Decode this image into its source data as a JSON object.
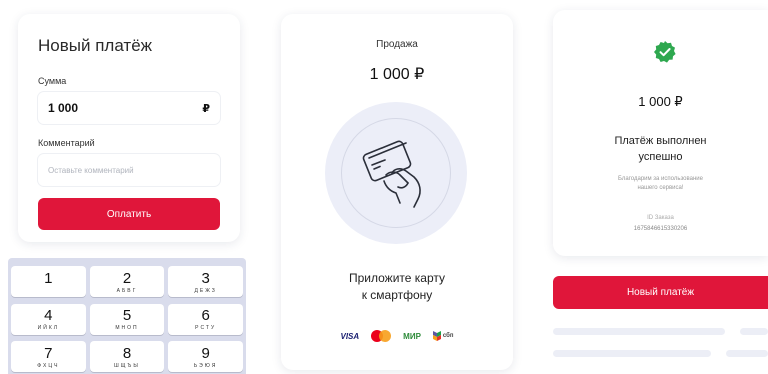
{
  "new_payment": {
    "title": "Новый платёж",
    "amount_label": "Сумма",
    "amount_value": "1 000",
    "currency_symbol": "₽",
    "comment_label": "Комментарий",
    "comment_placeholder": "Оставьте комментарий",
    "pay_button": "Оплатить"
  },
  "keypad": {
    "keys": [
      {
        "num": "1",
        "letters": ""
      },
      {
        "num": "2",
        "letters": "АБВГ"
      },
      {
        "num": "3",
        "letters": "ДЕЖЗ"
      },
      {
        "num": "4",
        "letters": "ИЙКЛ"
      },
      {
        "num": "5",
        "letters": "МНОП"
      },
      {
        "num": "6",
        "letters": "РСТУ"
      },
      {
        "num": "7",
        "letters": "ФХЦЧ"
      },
      {
        "num": "8",
        "letters": "ШЩЪЫ"
      },
      {
        "num": "9",
        "letters": "ЬЭЮЯ"
      }
    ]
  },
  "sale": {
    "label": "Продажа",
    "amount": "1 000 ₽",
    "instruction_line1": "Приложите карту",
    "instruction_line2": "к смартфону",
    "logos": {
      "visa": "VISA",
      "mir": "МИР",
      "sbp": "сбп"
    }
  },
  "success": {
    "amount": "1 000 ₽",
    "status_line1": "Платёж выполнен",
    "status_line2": "успешно",
    "thanks_line1": "Благодарим за использование",
    "thanks_line2": "нашего сервиса!",
    "id_label": "ID Заказа",
    "id_value": "1675846615330206",
    "new_payment_button": "Новый платёж"
  },
  "colors": {
    "accent_red": "#e0163a",
    "success_green": "#2ea84f",
    "keypad_bg": "#d9dcec"
  },
  "icons": {
    "nfc": "hand-holding-card-icon",
    "success": "check-badge-icon"
  }
}
